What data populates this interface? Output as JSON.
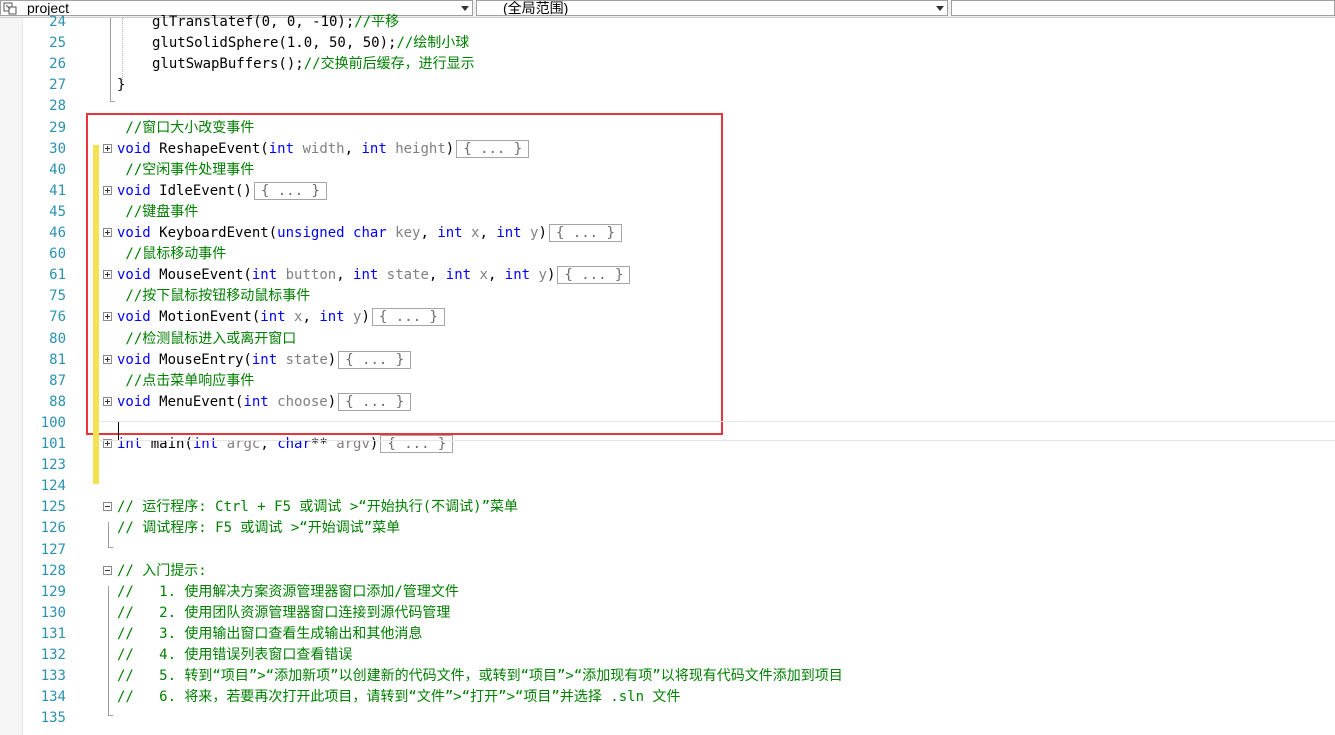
{
  "toolbar": {
    "project_combo": "project",
    "scope_combo": "(全局范围)"
  },
  "lines": [
    {
      "num": "24",
      "segments": [
        {
          "t": "glTranslatef(0, 0, -10);",
          "c": "n"
        },
        {
          "t": "//平移",
          "c": "cm"
        }
      ]
    },
    {
      "num": "25",
      "segments": [
        {
          "t": "glutSolidSphere(1.0, 50, 50);",
          "c": "n"
        },
        {
          "t": "//绘制小球",
          "c": "cm"
        }
      ]
    },
    {
      "num": "26",
      "segments": [
        {
          "t": "glutSwapBuffers();",
          "c": "n"
        },
        {
          "t": "//交换前后缓存，进行显示",
          "c": "cm"
        }
      ]
    },
    {
      "num": "27",
      "segments": [
        {
          "t": "}",
          "c": "n"
        }
      ]
    },
    {
      "num": "28",
      "segments": []
    },
    {
      "num": "29",
      "segments": [
        {
          "t": " //窗口大小改变事件",
          "c": "cm"
        }
      ]
    },
    {
      "num": "30",
      "segments": [
        {
          "t": "void",
          "c": "kw"
        },
        {
          "t": " ReshapeEvent(",
          "c": "n"
        },
        {
          "t": "int",
          "c": "kw"
        },
        {
          "t": " width",
          "c": "pm"
        },
        {
          "t": ", ",
          "c": "n"
        },
        {
          "t": "int",
          "c": "kw"
        },
        {
          "t": " height",
          "c": "pm"
        },
        {
          "t": ")",
          "c": "n"
        },
        {
          "t": "{ ... }",
          "c": "coll"
        }
      ]
    },
    {
      "num": "40",
      "segments": [
        {
          "t": " //空闲事件处理事件",
          "c": "cm"
        }
      ]
    },
    {
      "num": "41",
      "segments": [
        {
          "t": "void",
          "c": "kw"
        },
        {
          "t": " IdleEvent()",
          "c": "n"
        },
        {
          "t": "{ ... }",
          "c": "coll"
        }
      ]
    },
    {
      "num": "45",
      "segments": [
        {
          "t": " //键盘事件",
          "c": "cm"
        }
      ]
    },
    {
      "num": "46",
      "segments": [
        {
          "t": "void",
          "c": "kw"
        },
        {
          "t": " KeyboardEvent(",
          "c": "n"
        },
        {
          "t": "unsigned char",
          "c": "kw"
        },
        {
          "t": " key",
          "c": "pm"
        },
        {
          "t": ", ",
          "c": "n"
        },
        {
          "t": "int",
          "c": "kw"
        },
        {
          "t": " x",
          "c": "pm"
        },
        {
          "t": ", ",
          "c": "n"
        },
        {
          "t": "int",
          "c": "kw"
        },
        {
          "t": " y",
          "c": "pm"
        },
        {
          "t": ")",
          "c": "n"
        },
        {
          "t": "{ ... }",
          "c": "coll"
        }
      ]
    },
    {
      "num": "60",
      "segments": [
        {
          "t": " //鼠标移动事件",
          "c": "cm"
        }
      ]
    },
    {
      "num": "61",
      "segments": [
        {
          "t": "void",
          "c": "kw"
        },
        {
          "t": " MouseEvent(",
          "c": "n"
        },
        {
          "t": "int",
          "c": "kw"
        },
        {
          "t": " button",
          "c": "pm"
        },
        {
          "t": ", ",
          "c": "n"
        },
        {
          "t": "int",
          "c": "kw"
        },
        {
          "t": " state",
          "c": "pm"
        },
        {
          "t": ", ",
          "c": "n"
        },
        {
          "t": "int",
          "c": "kw"
        },
        {
          "t": " x",
          "c": "pm"
        },
        {
          "t": ", ",
          "c": "n"
        },
        {
          "t": "int",
          "c": "kw"
        },
        {
          "t": " y",
          "c": "pm"
        },
        {
          "t": ")",
          "c": "n"
        },
        {
          "t": "{ ... }",
          "c": "coll"
        }
      ]
    },
    {
      "num": "75",
      "segments": [
        {
          "t": " //按下鼠标按钮移动鼠标事件",
          "c": "cm"
        }
      ]
    },
    {
      "num": "76",
      "segments": [
        {
          "t": "void",
          "c": "kw"
        },
        {
          "t": " MotionEvent(",
          "c": "n"
        },
        {
          "t": "int",
          "c": "kw"
        },
        {
          "t": " x",
          "c": "pm"
        },
        {
          "t": ", ",
          "c": "n"
        },
        {
          "t": "int",
          "c": "kw"
        },
        {
          "t": " y",
          "c": "pm"
        },
        {
          "t": ")",
          "c": "n"
        },
        {
          "t": "{ ... }",
          "c": "coll"
        }
      ]
    },
    {
      "num": "80",
      "segments": [
        {
          "t": " //检测鼠标进入或离开窗口",
          "c": "cm"
        }
      ]
    },
    {
      "num": "81",
      "segments": [
        {
          "t": "void",
          "c": "kw"
        },
        {
          "t": " MouseEntry(",
          "c": "n"
        },
        {
          "t": "int",
          "c": "kw"
        },
        {
          "t": " state",
          "c": "pm"
        },
        {
          "t": ")",
          "c": "n"
        },
        {
          "t": "{ ... }",
          "c": "coll"
        }
      ]
    },
    {
      "num": "87",
      "segments": [
        {
          "t": " //点击菜单响应事件",
          "c": "cm"
        }
      ]
    },
    {
      "num": "88",
      "segments": [
        {
          "t": "void",
          "c": "kw"
        },
        {
          "t": " MenuEvent(",
          "c": "n"
        },
        {
          "t": "int",
          "c": "kw"
        },
        {
          "t": " choose",
          "c": "pm"
        },
        {
          "t": ")",
          "c": "n"
        },
        {
          "t": "{ ... }",
          "c": "coll"
        }
      ]
    },
    {
      "num": "100",
      "segments": []
    },
    {
      "num": "101",
      "segments": [
        {
          "t": "int",
          "c": "kw"
        },
        {
          "t": " main(",
          "c": "n"
        },
        {
          "t": "int",
          "c": "kw"
        },
        {
          "t": " argc",
          "c": "pm"
        },
        {
          "t": ", ",
          "c": "n"
        },
        {
          "t": "char",
          "c": "kw"
        },
        {
          "t": "**",
          "c": "n"
        },
        {
          "t": " argv",
          "c": "pm"
        },
        {
          "t": ")",
          "c": "n"
        },
        {
          "t": "{ ... }",
          "c": "coll"
        }
      ]
    },
    {
      "num": "123",
      "segments": []
    },
    {
      "num": "124",
      "segments": []
    },
    {
      "num": "125",
      "segments": [
        {
          "t": "// 运行程序: Ctrl + F5 或调试 >“开始执行(不调试)”菜单",
          "c": "cm"
        }
      ]
    },
    {
      "num": "126",
      "segments": [
        {
          "t": "// 调试程序: F5 或调试 >“开始调试”菜单",
          "c": "cm"
        }
      ]
    },
    {
      "num": "127",
      "segments": []
    },
    {
      "num": "128",
      "segments": [
        {
          "t": "// 入门提示: ",
          "c": "cm"
        }
      ]
    },
    {
      "num": "129",
      "segments": [
        {
          "t": "//   1. 使用解决方案资源管理器窗口添加/管理文件",
          "c": "cm"
        }
      ]
    },
    {
      "num": "130",
      "segments": [
        {
          "t": "//   2. 使用团队资源管理器窗口连接到源代码管理",
          "c": "cm"
        }
      ]
    },
    {
      "num": "131",
      "segments": [
        {
          "t": "//   3. 使用输出窗口查看生成输出和其他消息",
          "c": "cm"
        }
      ]
    },
    {
      "num": "132",
      "segments": [
        {
          "t": "//   4. 使用错误列表窗口查看错误",
          "c": "cm"
        }
      ]
    },
    {
      "num": "133",
      "segments": [
        {
          "t": "//   5. 转到“项目”>“添加新项”以创建新的代码文件，或转到“项目”>“添加现有项”以将现有代码文件添加到项目",
          "c": "cm"
        }
      ]
    },
    {
      "num": "134",
      "segments": [
        {
          "t": "//   6. 将来，若要再次打开此项目，请转到“文件”>“打开”>“项目”并选择 .sln 文件",
          "c": "cm"
        }
      ]
    },
    {
      "num": "135",
      "segments": []
    }
  ]
}
